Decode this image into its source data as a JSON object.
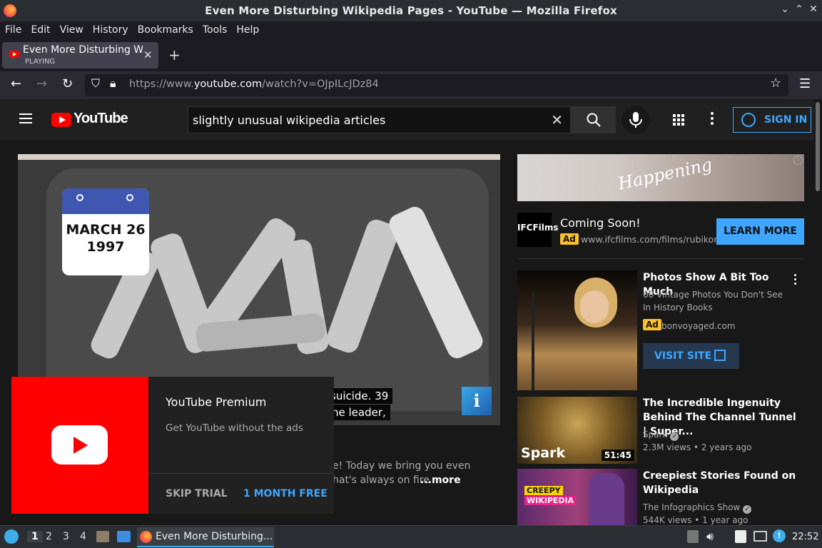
{
  "window": {
    "title": "Even More Disturbing Wikipedia Pages - YouTube — Mozilla Firefox"
  },
  "menu": [
    "File",
    "Edit",
    "View",
    "History",
    "Bookmarks",
    "Tools",
    "Help"
  ],
  "tab": {
    "title": "Even More Disturbing Wikipedia Pages - YouTube",
    "status": "PLAYING"
  },
  "url": {
    "prefix": "https://www.",
    "domain": "youtube.com",
    "path": "/watch?v=OJpILcJDz84"
  },
  "youtube": {
    "logo_text": "YouTube",
    "search_query": "slightly unusual wikipedia articles",
    "sign_in": "SIGN IN"
  },
  "video": {
    "calendar_date_line1": "MARCH 26",
    "calendar_date_line2": "1997",
    "caption_line1": "suicide. 39",
    "caption_line2": "he leader,",
    "description_line1": "e! Today we bring you even",
    "description_line2": "hat's always on fire",
    "more": "...more"
  },
  "premium_popup": {
    "title": "YouTube Premium",
    "subtitle": "Get YouTube without the ads",
    "skip": "SKIP TRIAL",
    "cta": "1 MONTH FREE"
  },
  "ad_banner": {
    "image_text": "Happening",
    "info": "i",
    "logo": "IFCFilms",
    "title": "Coming Soon!",
    "tag": "Ad",
    "url": "www.ifcfilms.com/films/rubikon",
    "button": "LEARN MORE"
  },
  "sidebar": {
    "ad_video": {
      "title": "Photos Show A Bit Too Much",
      "subtitle": "60 Vintage Photos You Don't See In History Books",
      "tag": "Ad",
      "domain": "bonvoyaged.com",
      "button": "VISIT SITE"
    },
    "videos": [
      {
        "title": "The Incredible Ingenuity Behind The Channel Tunnel | Super...",
        "channel": "Spark",
        "meta": "2.3M views • 2 years ago",
        "duration": "51:45",
        "thumb_text": "Spark"
      },
      {
        "title": "Creepiest Stories Found on Wikipedia",
        "channel": "The Infographics Show",
        "meta": "544K views • 1 year ago",
        "thumb_text_1": "CREEPY",
        "thumb_text_2": "WIKIPEDIA"
      }
    ]
  },
  "taskbar": {
    "workspaces": [
      "1",
      "2",
      "3",
      "4"
    ],
    "app_title": "Even More Disturbing...",
    "clock": "22:52"
  },
  "colors": {
    "accent": "#3ea6ff",
    "youtube_red": "#ff0000",
    "ad_tag": "#fbc02d"
  }
}
